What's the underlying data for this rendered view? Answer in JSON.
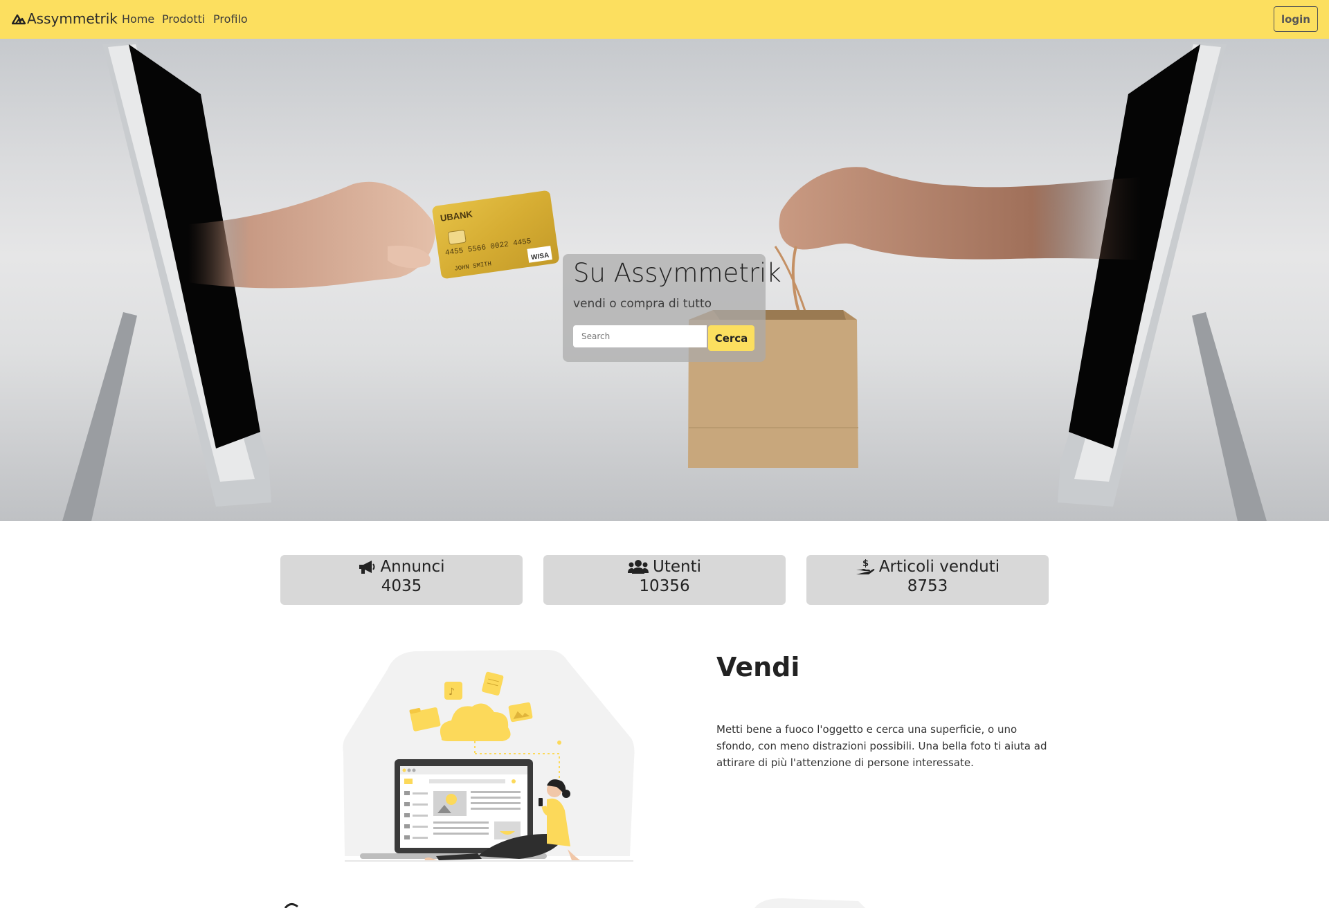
{
  "navbar": {
    "brand": "Assymmetrik",
    "links": [
      "Home",
      "Prodotti",
      "Profilo"
    ],
    "login_label": "login"
  },
  "hero": {
    "title": "Su Assymmetrik",
    "subtitle": "vendi o compra di tutto",
    "search_placeholder": "Search",
    "search_button": "Cerca",
    "card_bank": "UBANK",
    "card_number": "4455 5566 0022 4455",
    "card_holder": "JOHN SMITH",
    "card_network": "WISA"
  },
  "stats": [
    {
      "label": "Annunci",
      "value": "4035",
      "icon": "megaphone-icon"
    },
    {
      "label": "Utenti",
      "value": "10356",
      "icon": "users-icon"
    },
    {
      "label": "Articoli venduti",
      "value": "8753",
      "icon": "hand-money-icon"
    }
  ],
  "sell_section": {
    "title": "Vendi",
    "text": "Metti bene a fuoco l'oggetto e cerca una superficie, o uno sfondo, con meno distrazioni possibili. Una bella foto ti aiuta ad attirare di più l'attenzione di persone interessate."
  },
  "colors": {
    "accent": "#fcdf5f",
    "stat_card": "#d8d8d8"
  }
}
